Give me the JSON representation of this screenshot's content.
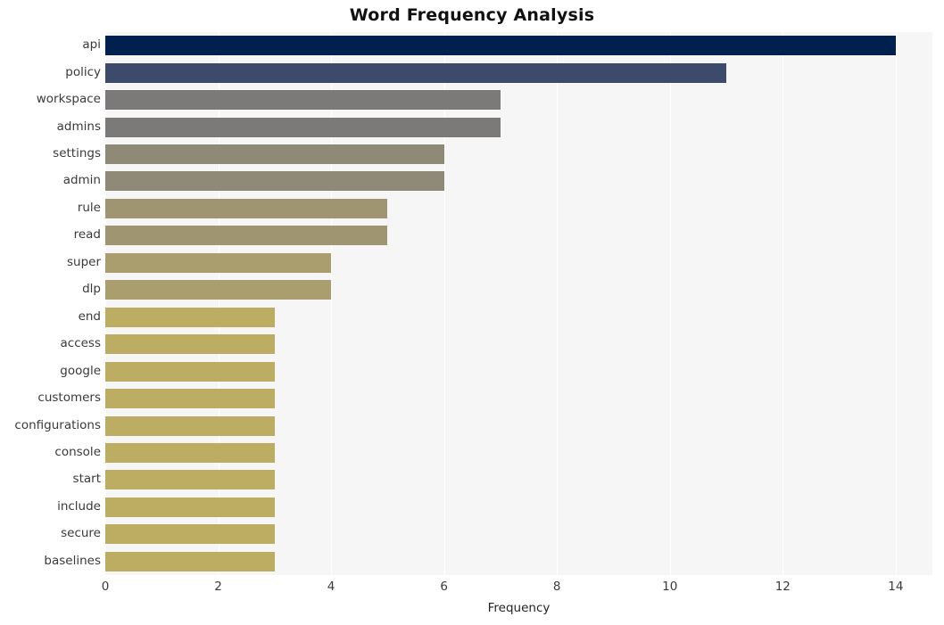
{
  "chart_data": {
    "type": "bar",
    "orientation": "horizontal",
    "title": "Word Frequency Analysis",
    "xlabel": "Frequency",
    "ylabel": "",
    "xlim": [
      0,
      14.65
    ],
    "xticks": [
      0,
      2,
      4,
      6,
      8,
      10,
      12,
      14
    ],
    "xtick_labels": [
      "0",
      "2",
      "4",
      "6",
      "8",
      "10",
      "12",
      "14"
    ],
    "grid": true,
    "grid_axis": "x",
    "legend": "none",
    "categories": [
      "api",
      "policy",
      "workspace",
      "admins",
      "settings",
      "admin",
      "rule",
      "read",
      "super",
      "dlp",
      "end",
      "access",
      "google",
      "customers",
      "configurations",
      "console",
      "start",
      "include",
      "secure",
      "baselines"
    ],
    "values": [
      14,
      11,
      7,
      7,
      6,
      6,
      5,
      5,
      4,
      4,
      3,
      3,
      3,
      3,
      3,
      3,
      3,
      3,
      3,
      3
    ],
    "bar_colors": [
      "#00204d",
      "#3c4a6b",
      "#7b7a78",
      "#7b7a78",
      "#8e8a77",
      "#8e8a77",
      "#a09571",
      "#a09571",
      "#aa9d6e",
      "#aa9d6e",
      "#bcad63",
      "#bcad63",
      "#bcad63",
      "#bcad63",
      "#bcad63",
      "#bcad63",
      "#bcad63",
      "#bcad63",
      "#bcad63",
      "#bcad63"
    ],
    "colormap": "cividis",
    "plot_background": "#f6f6f6",
    "grid_color": "#ffffff",
    "figure_background": "#ffffff"
  }
}
